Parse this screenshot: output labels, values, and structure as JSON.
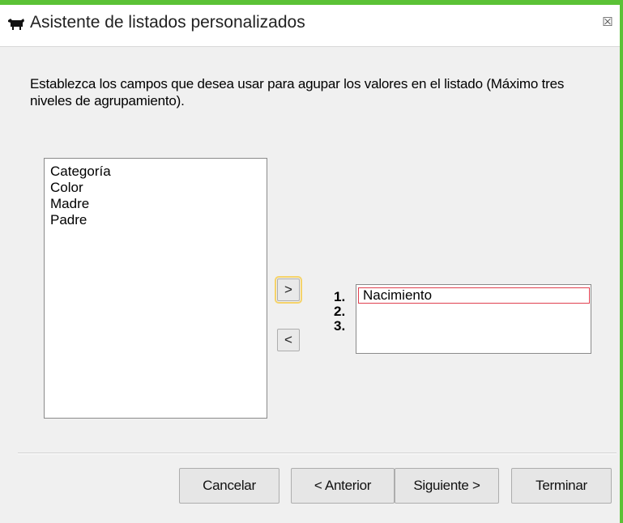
{
  "window": {
    "title": "Asistente de listados personalizados",
    "icon": "cow-icon",
    "close_glyph": "☒"
  },
  "instructions": "Establezca los campos que desea usar para agupar los valores en el listado (Máximo tres niveles de agrupamiento).",
  "available_fields": [
    "Categoría",
    "Color",
    "Madre",
    "Padre"
  ],
  "arrows": {
    "add": ">",
    "remove": "<"
  },
  "levels": [
    "1.",
    "2.",
    "3."
  ],
  "group_fields": [
    "Nacimiento"
  ],
  "buttons": {
    "cancel": "Cancelar",
    "previous": "< Anterior",
    "next": "Siguiente >",
    "finish": "Terminar"
  },
  "colors": {
    "accent_strip": "#5bc236",
    "selection_border": "#e04050",
    "focus": "#f5d36a"
  }
}
